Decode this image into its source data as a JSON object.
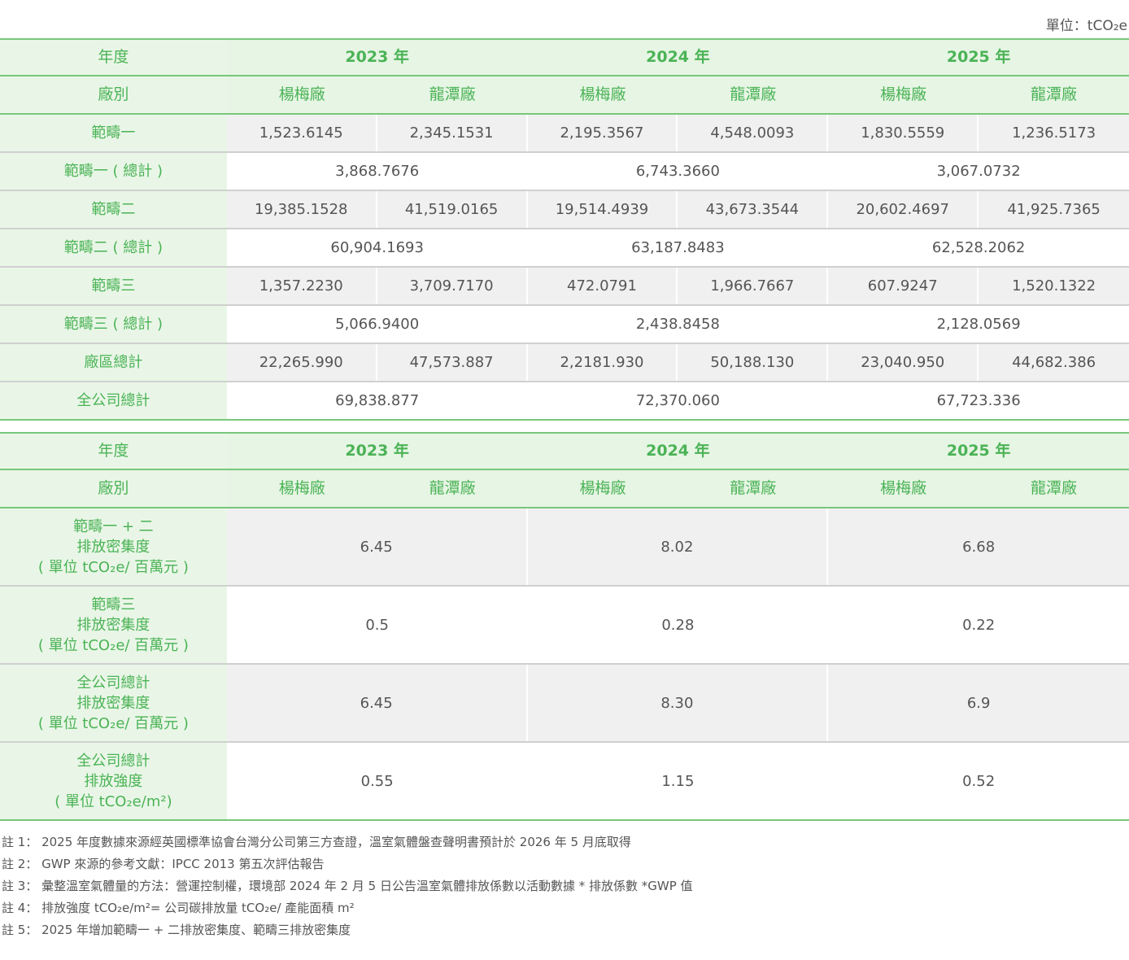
{
  "unit_label": "單位：tCO₂e",
  "table1": {
    "header": {
      "year_label": "年度",
      "years": [
        "2023 年",
        "2024 年",
        "2025 年"
      ],
      "plant_label": "廠別",
      "plants": [
        "楊梅廠",
        "龍潭廠",
        "楊梅廠",
        "龍潭廠",
        "楊梅廠",
        "龍潭廠"
      ]
    },
    "rows": [
      {
        "label": "範疇一",
        "values": [
          "1,523.6145",
          "2,345.1531",
          "2,195.3567",
          "4,548.0093",
          "1,830.5559",
          "1,236.5173"
        ]
      },
      {
        "label": "範疇一 ( 總計 )",
        "totals": [
          "3,868.7676",
          "6,743.3660",
          "3,067.0732"
        ]
      },
      {
        "label": "範疇二",
        "values": [
          "19,385.1528",
          "41,519.0165",
          "19,514.4939",
          "43,673.3544",
          "20,602.4697",
          "41,925.7365"
        ]
      },
      {
        "label": "範疇二 ( 總計 )",
        "totals": [
          "60,904.1693",
          "63,187.8483",
          "62,528.2062"
        ]
      },
      {
        "label": "範疇三",
        "values": [
          "1,357.2230",
          "3,709.7170",
          "472.0791",
          "1,966.7667",
          "607.9247",
          "1,520.1322"
        ]
      },
      {
        "label": "範疇三 ( 總計 )",
        "totals": [
          "5,066.9400",
          "2,438.8458",
          "2,128.0569"
        ]
      },
      {
        "label": "廠區總計",
        "values": [
          "22,265.990",
          "47,573.887",
          "2,2181.930",
          "50,188.130",
          "23,040.950",
          "44,682.386"
        ]
      },
      {
        "label": "全公司總計",
        "totals": [
          "69,838.877",
          "72,370.060",
          "67,723.336"
        ]
      }
    ]
  },
  "table2": {
    "header": {
      "year_label": "年度",
      "years": [
        "2023 年",
        "2024 年",
        "2025 年"
      ],
      "plant_label": "廠別",
      "plants": [
        "楊梅廠",
        "龍潭廠",
        "楊梅廠",
        "龍潭廠",
        "楊梅廠",
        "龍潭廠"
      ]
    },
    "rows": [
      {
        "label_lines": [
          "範疇一 + 二",
          "排放密集度",
          "( 單位 tCO₂e/ 百萬元 )"
        ],
        "totals": [
          "6.45",
          "8.02",
          "6.68"
        ]
      },
      {
        "label_lines": [
          "範疇三",
          "排放密集度",
          "( 單位 tCO₂e/ 百萬元 )"
        ],
        "totals": [
          "0.5",
          "0.28",
          "0.22"
        ]
      },
      {
        "label_lines": [
          "全公司總計",
          "排放密集度",
          "( 單位 tCO₂e/ 百萬元 )"
        ],
        "totals": [
          "6.45",
          "8.30",
          "6.9"
        ]
      },
      {
        "label_lines": [
          "全公司總計",
          "排放強度",
          "( 單位 tCO₂e/m²)"
        ],
        "totals": [
          "0.55",
          "1.15",
          "0.52"
        ]
      }
    ]
  },
  "notes": [
    "註 1： 2025 年度數據來源經英國標準協會台灣分公司第三方查證，溫室氣體盤查聲明書預計於 2026 年 5 月底取得",
    "註 2： GWP 來源的參考文獻：IPCC 2013 第五次評估報告",
    "註 3： 彙整溫室氣體量的方法：營運控制權，環境部 2024 年 2 月 5 日公告溫室氣體排放係數以活動數據 * 排放係數 *GWP 值",
    "註 4： 排放強度 tCO₂e/m²= 公司碳排放量 tCO₂e/ 產能面積 m²",
    "註 5： 2025 年增加範疇一 + 二排放密集度、範疇三排放密集度"
  ]
}
